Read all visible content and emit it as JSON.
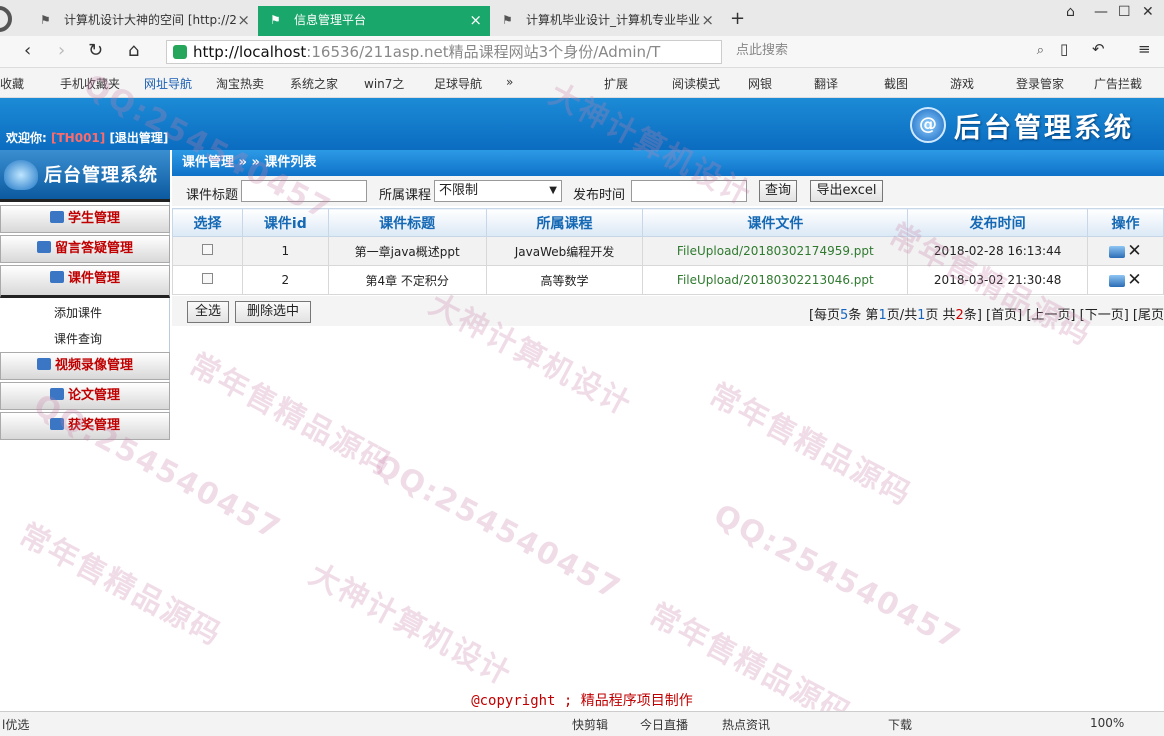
{
  "browser": {
    "tabs": [
      {
        "label": "计算机设计大神的空间 [http://2"
      },
      {
        "label": "信息管理平台"
      },
      {
        "label": "计算机毕业设计_计算机专业毕业"
      }
    ],
    "new_tab": "+",
    "url_host": "http://localhost",
    "url_rest": ":16536/211asp.net精品课程网站3个身份/Admin/T",
    "search_placeholder": "点此搜索",
    "bookmarks": [
      "收藏",
      "手机收藏夹",
      "网址导航",
      "淘宝热卖",
      "系统之家",
      "win7之",
      "足球导航",
      "»"
    ],
    "tools": [
      "扩展",
      "阅读模式",
      "网银",
      "翻译",
      "截图",
      "游戏",
      "登录管家",
      "广告拦截"
    ]
  },
  "header": {
    "welcome_label": "欢迎你:",
    "user": "[TH001]",
    "logout": "[退出管理]",
    "logo_mark": "@",
    "logo_text": "后台管理系统"
  },
  "sidebar": {
    "logo_text": "后台管理系统",
    "menus": [
      "学生管理",
      "留言答疑管理",
      "课件管理",
      "视频录像管理",
      "论文管理",
      "获奖管理"
    ],
    "submenus": [
      "添加课件",
      "课件查询"
    ]
  },
  "breadcrumb": "课件管理 » » 课件列表",
  "filters": {
    "title_label": "课件标题",
    "title_value": "",
    "course_label": "所属课程",
    "course_selected": "不限制",
    "time_label": "发布时间",
    "time_value": "",
    "query_button": "查询",
    "export_button": "导出excel"
  },
  "table": {
    "headers": [
      "选择",
      "课件id",
      "课件标题",
      "所属课程",
      "课件文件",
      "发布时间",
      "操作"
    ],
    "rows": [
      {
        "id": "1",
        "title": "第一章java概述ppt",
        "course": "JavaWeb编程开发",
        "file": "FileUpload/20180302174959.ppt",
        "time": "2018-02-28 16:13:44"
      },
      {
        "id": "2",
        "title": "第4章 不定积分",
        "course": "高等数学",
        "file": "FileUpload/20180302213046.ppt",
        "time": "2018-03-02 21:30:48"
      }
    ]
  },
  "actions": {
    "select_all": "全选",
    "delete_selected": "删除选中"
  },
  "pager": {
    "per_page_prefix": "[每页",
    "per_page": "5",
    "per_page_mid": "条 第",
    "current": "1",
    "total_mid": "页/共",
    "total_pages": "1",
    "count_mid": "页 共",
    "total_items": "2",
    "count_suffix": "条]",
    "first": "[首页]",
    "prev": "[上一页]",
    "next": "[下一页]",
    "last": "[尾页"
  },
  "copyright": "@copyright ; 精品程序项目制作",
  "statusbar": {
    "left": "l优选",
    "items": [
      "快剪辑",
      "今日直播",
      "热点资讯",
      "下载"
    ],
    "zoom": "100%"
  },
  "watermarks": [
    "常年售精品源码",
    "QQ:254540457",
    "大神计算机设计"
  ],
  "colors": {
    "accent_green": "#1aa76b",
    "header_blue": "#0b6cc0",
    "menu_red": "#c00000",
    "link_green": "#2f7a2f"
  }
}
